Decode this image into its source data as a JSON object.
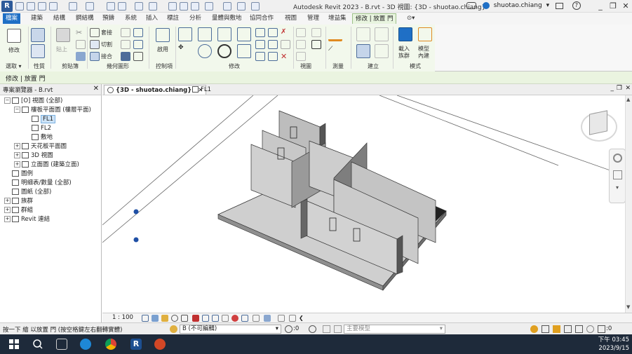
{
  "titlebar": {
    "logo": "R",
    "title": "Autodesk Revit 2023 - B.rvt - 3D 視圖: {3D - shuotao.chiang}",
    "user": "shuotao.chiang",
    "help": "?",
    "minimize": "_",
    "restore": "❐",
    "close": "✕"
  },
  "tabs": [
    "檔案",
    "建築",
    "結構",
    "鋼結構",
    "預鑄",
    "系統",
    "插入",
    "標註",
    "分析",
    "量體與敷地",
    "協同合作",
    "視圖",
    "管理",
    "增益集",
    "修改 | 放置 門"
  ],
  "ribbon": {
    "groups": [
      "選取 ▾",
      "性質",
      "剪貼簿",
      "幾何圖形",
      "控制項",
      "修改",
      "視圖",
      "測量",
      "建立",
      "模式"
    ],
    "modify_label": "修改",
    "paste_label": "貼上",
    "cut_label": "切割",
    "join_label": "接合",
    "attach_label": "套接",
    "activate_label": "啟用",
    "load_family_label": "載入\n族群",
    "inplace_label": "模型\n內建"
  },
  "context_bar": "修改 | 放置 門",
  "browser": {
    "title": "專案瀏覽器 - B.rvt",
    "close": "✕",
    "items": [
      {
        "label": "[O] 視圖 (全部)",
        "depth": 0,
        "exp": "−"
      },
      {
        "label": "樓板平面圖 (樓層平面)",
        "depth": 1,
        "exp": "−"
      },
      {
        "label": "FL1",
        "depth": 2,
        "exp": "",
        "selected": true
      },
      {
        "label": "FL2",
        "depth": 2,
        "exp": ""
      },
      {
        "label": "敷地",
        "depth": 2,
        "exp": ""
      },
      {
        "label": "天花板平面圖",
        "depth": 1,
        "exp": "+"
      },
      {
        "label": "3D 視圖",
        "depth": 1,
        "exp": "+"
      },
      {
        "label": "立面圖 (建築立面)",
        "depth": 1,
        "exp": "+"
      },
      {
        "label": "圖例",
        "depth": 0,
        "exp": ""
      },
      {
        "label": "明細表/數量 (全部)",
        "depth": 0,
        "exp": ""
      },
      {
        "label": "圖紙 (全部)",
        "depth": 0,
        "exp": ""
      },
      {
        "label": "族群",
        "depth": 0,
        "exp": "+"
      },
      {
        "label": "群組",
        "depth": 0,
        "exp": "+"
      },
      {
        "label": "Revit 連結",
        "depth": 0,
        "exp": "+"
      }
    ]
  },
  "view_tabs": [
    {
      "label": "{3D - shuotao.chiang}",
      "close": "✕"
    },
    {
      "label": "FL1",
      "close": ""
    }
  ],
  "view_control": {
    "scale": "1 : 100"
  },
  "status": {
    "text": "按一下 繪 以放置 門 (按空格鍵左右翻轉實體)",
    "workset": "B (不可編輯)",
    "model": "主要模型",
    "count": ":0",
    "filter": ":0"
  },
  "taskbar": {
    "time": "下午 03:45",
    "date": "2023/9/15"
  },
  "colors": {
    "accent": "#1f6fc5",
    "context_green": "#eaf4e0",
    "taskbar": "#1e2a3a"
  }
}
